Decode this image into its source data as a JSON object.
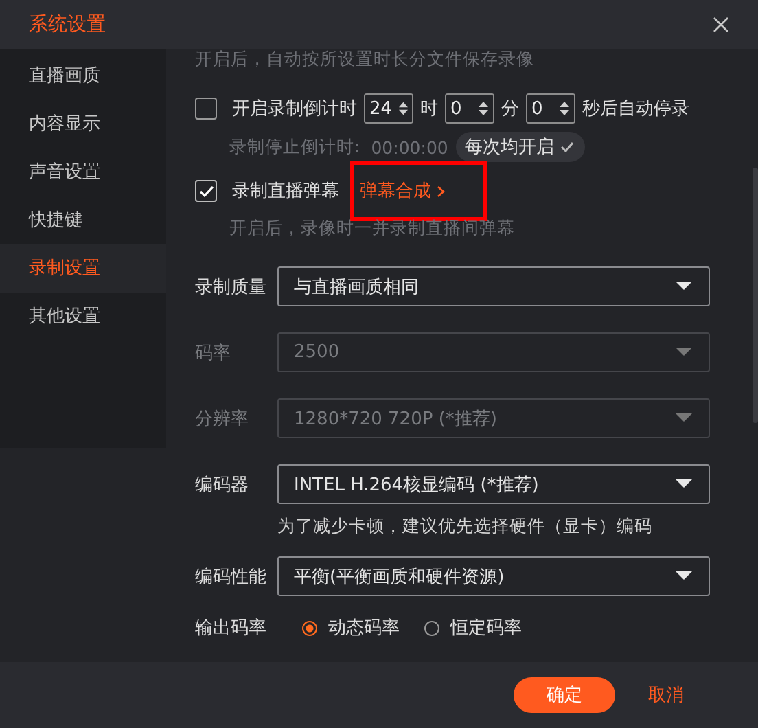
{
  "window": {
    "title": "系统设置"
  },
  "sidebar": {
    "items": [
      {
        "label": "直播画质",
        "selected": false
      },
      {
        "label": "内容显示",
        "selected": false
      },
      {
        "label": "声音设置",
        "selected": false
      },
      {
        "label": "快捷键",
        "selected": false
      },
      {
        "label": "录制设置",
        "selected": true
      },
      {
        "label": "其他设置",
        "selected": false
      }
    ]
  },
  "top_hint": "开启后，自动按所设置时长分文件保存录像",
  "countdown": {
    "checked": false,
    "label": "开启录制倒计时",
    "fields": [
      {
        "value": "24",
        "unit": "时"
      },
      {
        "value": "0",
        "unit": "分"
      },
      {
        "value": "0",
        "unit": "秒后自动停录"
      }
    ],
    "status_label": "录制停止倒计时:",
    "status_time": "00:00:00",
    "chip": "每次均开启"
  },
  "danmu": {
    "checked": true,
    "label": "录制直播弹幕",
    "link": "弹幕合成",
    "link_highlighted": true,
    "hint": "开启后，录像时一并录制直播间弹幕"
  },
  "selects": [
    {
      "label": "录制质量",
      "value": "与直播画质相同",
      "disabled": false
    },
    {
      "label": "码率",
      "value": "2500",
      "disabled": true
    },
    {
      "label": "分辨率",
      "value": "1280*720 720P (*推荐)",
      "disabled": true
    },
    {
      "label": "编码器",
      "value": "INTEL H.264核显编码 (*推荐)",
      "disabled": false,
      "hint": "为了减少卡顿，建议优先选择硬件（显卡）编码"
    },
    {
      "label": "编码性能",
      "value": "平衡(平衡画质和硬件资源)",
      "disabled": false
    }
  ],
  "output_rate": {
    "label": "输出码率",
    "options": [
      {
        "label": "动态码率",
        "selected": true
      },
      {
        "label": "恒定码率",
        "selected": false
      }
    ]
  },
  "buttons": [
    {
      "label": "确定",
      "kind": "primary"
    },
    {
      "label": "取消",
      "kind": "secondary"
    }
  ]
}
